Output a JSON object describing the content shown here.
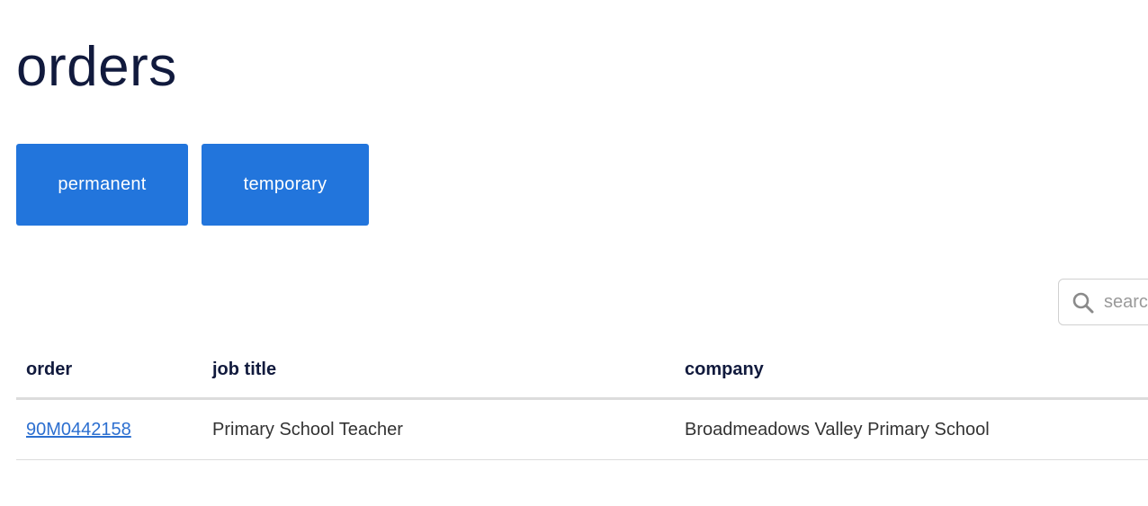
{
  "page": {
    "title": "orders"
  },
  "tabs": {
    "permanent_label": "permanent",
    "temporary_label": "temporary",
    "accent_color": "#2275dc"
  },
  "search": {
    "placeholder": "search",
    "value": ""
  },
  "table": {
    "headers": {
      "order": "order",
      "job_title": "job title",
      "company": "company"
    },
    "rows": [
      {
        "order": "90M0442158",
        "job_title": "Primary School Teacher",
        "company": "Broadmeadows Valley Primary School"
      }
    ]
  },
  "icons": {
    "search": "search-icon"
  }
}
